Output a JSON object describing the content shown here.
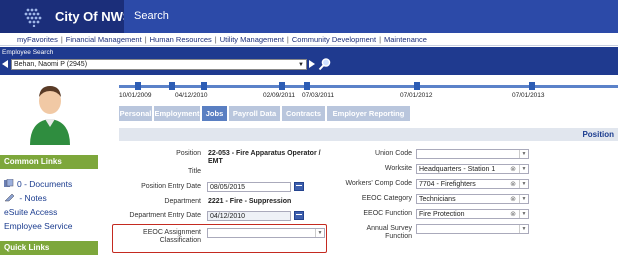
{
  "header": {
    "brand": "City Of NWS",
    "search_tab": "Search"
  },
  "nav": {
    "items": [
      "myFavorites",
      "Financial Management",
      "Human Resources",
      "Utility Management",
      "Community Development",
      "Maintenance"
    ]
  },
  "employee_search": {
    "label": "Employee Search",
    "selected": "Behan, Naomi P (2945)"
  },
  "sidebar": {
    "common_links_header": "Common Links",
    "common_links": [
      "0 - Documents",
      " - Notes",
      "eSuite Access",
      "Employee Service"
    ],
    "quick_links_header": "Quick Links"
  },
  "timeline": {
    "dates": [
      "10/01/2009",
      "04/12/2010",
      "02/09/2011",
      "07/03/2011",
      "07/01/2012",
      "07/01/2013"
    ]
  },
  "tabs": [
    "Personal",
    "Employment",
    "Jobs",
    "Payroll Data",
    "Contracts",
    "Employer Reporting"
  ],
  "active_tab": "Jobs",
  "section_title": "Position",
  "form_left": {
    "position_label": "Position",
    "position_value": "22-053 - Fire Apparatus Operator / EMT",
    "title_label": "Title",
    "position_entry_date_label": "Position Entry Date",
    "position_entry_date_value": "08/05/2015",
    "department_label": "Department",
    "department_value": "2221 - Fire - Suppression",
    "department_entry_date_label": "Department Entry Date",
    "department_entry_date_value": "04/12/2010",
    "eeoc_assignment_label": "EEOC Assignment Classification",
    "eeoc_assignment_value": ""
  },
  "form_right": {
    "union_code_label": "Union Code",
    "union_code_value": "",
    "worksite_label": "Worksite",
    "worksite_value": "Headquarters - Station 1",
    "workers_comp_label": "Workers' Comp Code",
    "workers_comp_value": "7704 - Firefighters",
    "eeoc_category_label": "EEOC Category",
    "eeoc_category_value": "Technicians",
    "eeoc_function_label": "EEOC Function",
    "eeoc_function_value": "Fire Protection",
    "annual_survey_label": "Annual Survey Function",
    "annual_survey_value": ""
  },
  "colors": {
    "header_bg": "#1b2e7a",
    "sidebar_header": "#7da73b",
    "active_tab": "#5a7fc2",
    "highlight_border": "#c42a20"
  }
}
